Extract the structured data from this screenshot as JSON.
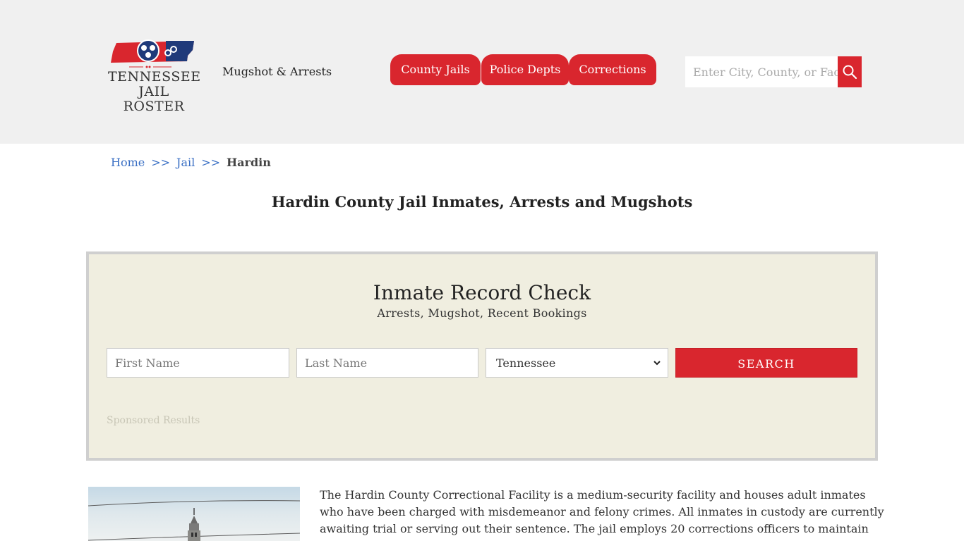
{
  "header": {
    "logo_line1": "TENNESSEE",
    "logo_line2": "JAIL ROSTER",
    "tagline": "Mugshot & Arrests",
    "nav": [
      {
        "label": "County Jails"
      },
      {
        "label": "Police Depts"
      },
      {
        "label": "Corrections"
      }
    ],
    "search_placeholder": "Enter City, County, or Facility",
    "search_icon": "magnifier-icon"
  },
  "breadcrumb": {
    "items": [
      "Home",
      "Jail"
    ],
    "separator": ">>",
    "current": "Hardin"
  },
  "page_title": "Hardin County Jail Inmates, Arrests and Mugshots",
  "record_check": {
    "title": "Inmate Record Check",
    "subtitle": "Arrests, Mugshot, Recent Bookings",
    "first_name_placeholder": "First Name",
    "last_name_placeholder": "Last Name",
    "state_selected": "Tennessee",
    "submit_label": "SEARCH",
    "sponsored_label": "Sponsored Results"
  },
  "description": "The Hardin County Correctional Facility is a medium-security facility and houses adult inmates who have been charged with misdemeanor and felony crimes. All inmates in custody are currently awaiting trial or serving out their sentence. The jail employs 20 corrections officers to maintain security, control",
  "colors": {
    "accent_red": "#d9262e",
    "header_bg": "#f0f0f0",
    "box_bg": "#f0eee0",
    "link_blue": "#3a6fc4"
  }
}
